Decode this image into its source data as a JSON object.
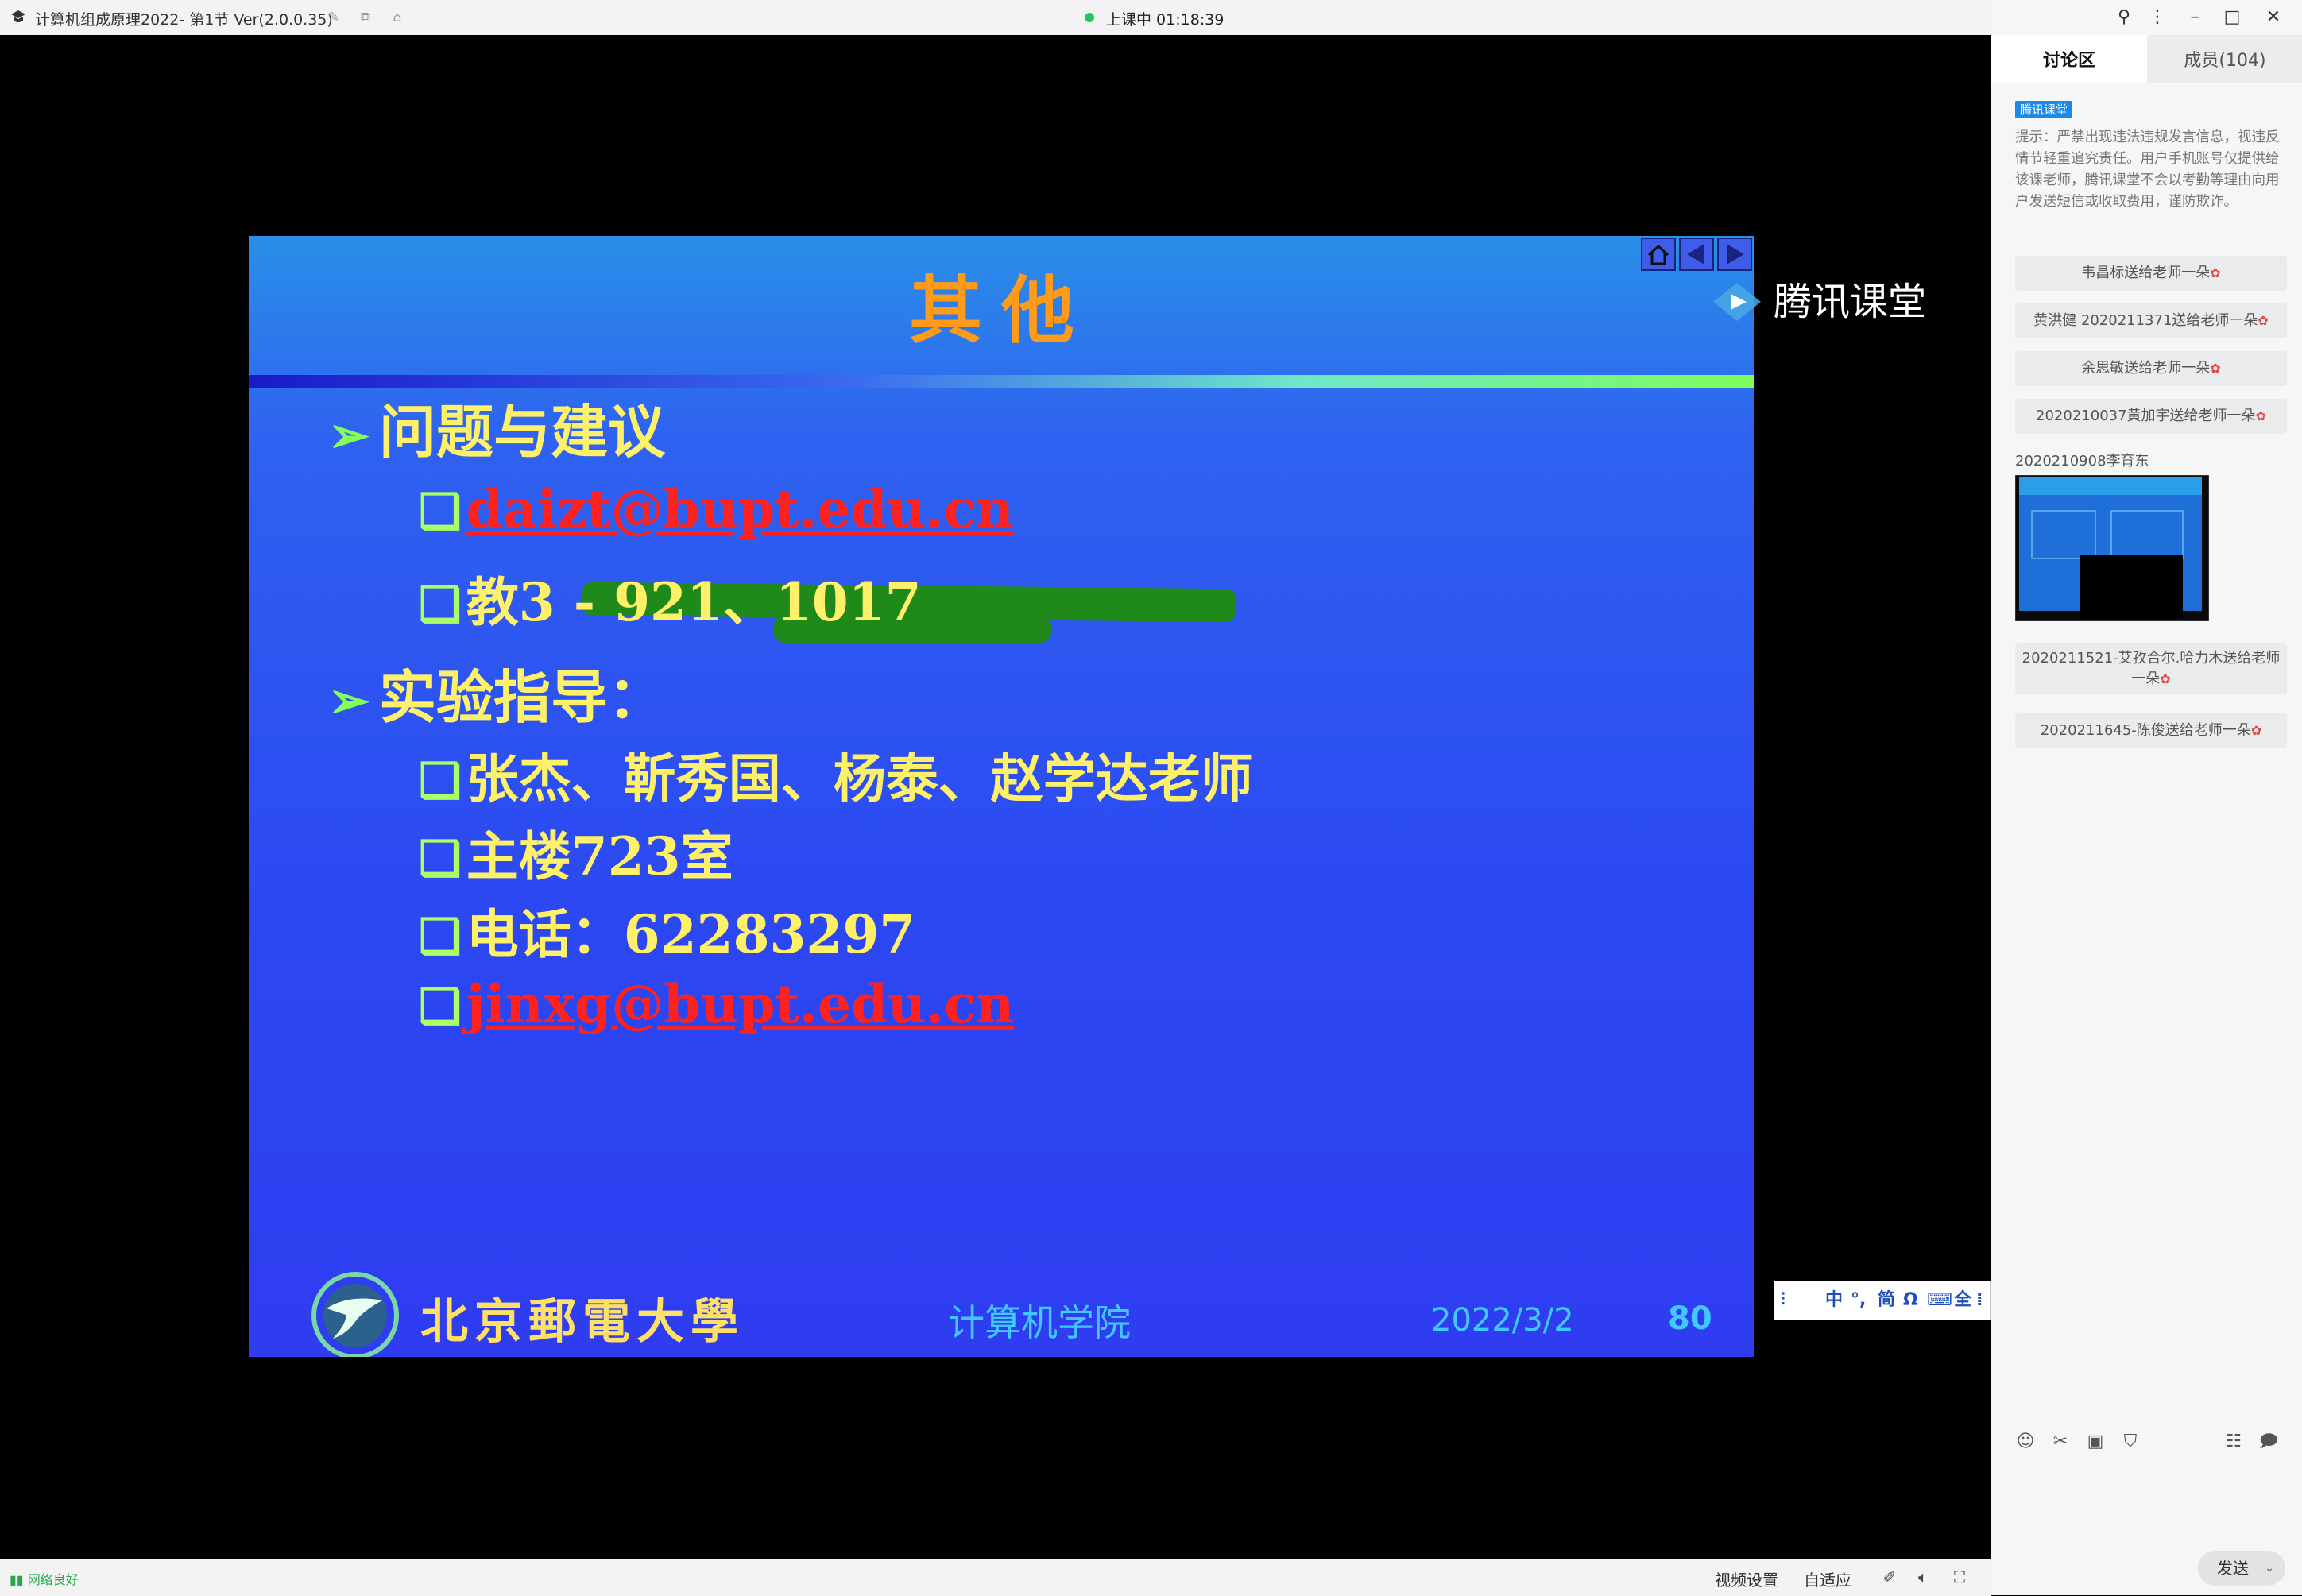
{
  "window": {
    "title": "计算机组成原理2022- 第1节 Ver(2.0.0.35)",
    "status": "上课中 01:18:39",
    "status_color": "#22c55e"
  },
  "sidebar": {
    "tabs": [
      {
        "label": "讨论区",
        "active": true
      },
      {
        "label": "成员(104)",
        "active": false
      }
    ],
    "notice_badge": "腾讯课堂",
    "notice_text": "提示：严禁出现违法违规发言信息，视违反情节轻重追究责任。用户手机账号仅提供给该课老师，腾讯课堂不会以考勤等理由向用户发送短信或收取费用，谨防欺诈。",
    "messages": [
      {
        "text": "韦昌标送给老师一朵"
      },
      {
        "text": "黄洪健 2020211371送给老师一朵"
      },
      {
        "text": "余思敏送给老师一朵"
      },
      {
        "text": "2020210037黄加宇送给老师一朵"
      }
    ],
    "image_message_sender": "2020210908李育东",
    "messages_after": [
      {
        "text": "2020211521-艾孜合尔.哈力木送给老师一朵"
      },
      {
        "text": "2020211645-陈俊送给老师一朵"
      }
    ],
    "flower_icon": "flower-icon",
    "send_label": "发送"
  },
  "slide": {
    "title": "其他",
    "items": [
      {
        "level": 1,
        "text": "问题与建议"
      },
      {
        "level": 2,
        "text": "daizt@bupt.edu.cn",
        "link": true
      },
      {
        "level": 2,
        "text": "教3 - 921、1017"
      },
      {
        "level": 1,
        "text": "实验指导："
      },
      {
        "level": 2,
        "text": "张杰、靳秀国、杨泰、赵学达老师"
      },
      {
        "level": 2,
        "text": "主楼723室"
      },
      {
        "level": 2,
        "text": "电话：62283297"
      },
      {
        "level": 2,
        "text": "jinxg@bupt.edu.cn",
        "link": true
      }
    ],
    "footer": {
      "university": "北京郵電大學",
      "department": "计算机学院",
      "date": "2022/3/2",
      "page": "80"
    }
  },
  "watermark": "腾讯课堂",
  "ime": {
    "items": [
      "中",
      "°,",
      "简",
      "Ω",
      "⌨",
      "全"
    ]
  },
  "bottombar": {
    "network": "网络良好",
    "video_settings": "视频设置",
    "fit": "自适应"
  },
  "colors": {
    "slide_title": "#ff9a1a",
    "slide_text": "#fff06a",
    "link": "#ff2020",
    "footer_text": "#40c8ff"
  }
}
